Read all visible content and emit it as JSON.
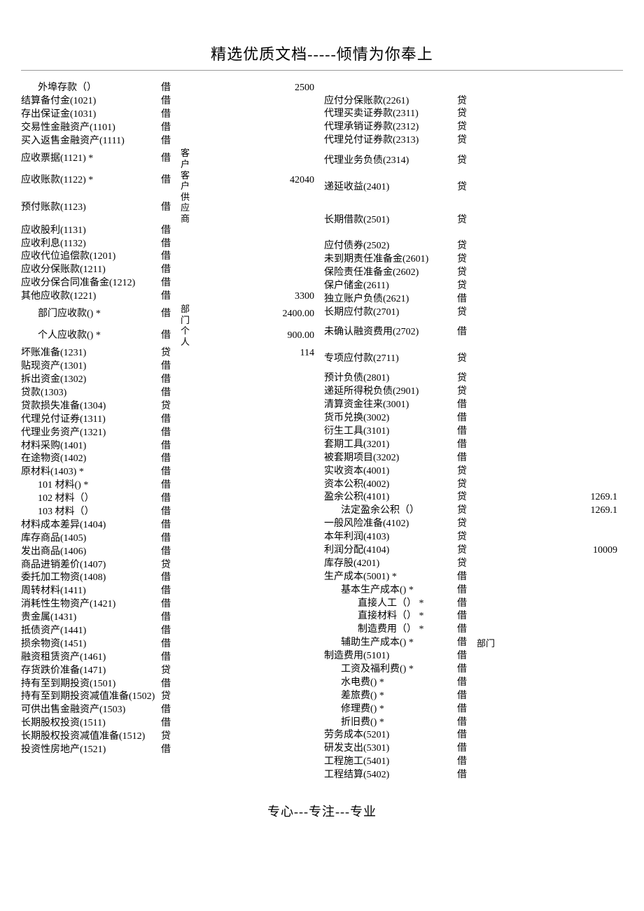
{
  "header_title": "精选优质文档-----倾情为你奉上",
  "footer_text": "专心---专注---专业",
  "left_rows": [
    {
      "label": "外埠存款（）",
      "dc": "借",
      "ex": "",
      "val": "2500",
      "indent": 1
    },
    {
      "label": "结算备付金(1021)",
      "dc": "借",
      "ex": "",
      "val": ""
    },
    {
      "label": "存出保证金(1031)",
      "dc": "借",
      "ex": "",
      "val": ""
    },
    {
      "label": "交易性金融资产(1101)",
      "dc": "借",
      "ex": "",
      "val": ""
    },
    {
      "label": "买入返售金融资产(1111)",
      "dc": "借",
      "ex": "",
      "val": ""
    },
    {
      "label": "应收票据(1121) *",
      "dc": "借",
      "ex": "客\n户",
      "val": "",
      "multiline": true
    },
    {
      "label": "应收账款(1122) *",
      "dc": "借",
      "ex": "客\n户",
      "val": "42040",
      "multiline": true
    },
    {
      "label": "预付账款(1123)",
      "dc": "借",
      "ex": "供\n应\n商",
      "val": "",
      "multiline": true
    },
    {
      "label": "应收股利(1131)",
      "dc": "借",
      "ex": "",
      "val": ""
    },
    {
      "label": "应收利息(1132)",
      "dc": "借",
      "ex": "",
      "val": ""
    },
    {
      "label": "应收代位追偿款(1201)",
      "dc": "借",
      "ex": "",
      "val": ""
    },
    {
      "label": "应收分保账款(1211)",
      "dc": "借",
      "ex": "",
      "val": ""
    },
    {
      "label": "应收分保合同准备金(1212)",
      "dc": "借",
      "ex": "",
      "val": ""
    },
    {
      "label": "其他应收款(1221)",
      "dc": "借",
      "ex": "",
      "val": "3300"
    },
    {
      "label": "部门应收款() *",
      "dc": "借",
      "ex": "部\n门",
      "val": "2400.00",
      "indent": 1,
      "multiline": true
    },
    {
      "label": "个人应收款() *",
      "dc": "借",
      "ex": "个\n人",
      "val": "900.00",
      "indent": 1,
      "multiline": true
    },
    {
      "label": "坏账准备(1231)",
      "dc": "贷",
      "ex": "",
      "val": "114"
    },
    {
      "label": "贴现资产(1301)",
      "dc": "借",
      "ex": "",
      "val": ""
    },
    {
      "label": "拆出资金(1302)",
      "dc": "借",
      "ex": "",
      "val": ""
    },
    {
      "label": "贷款(1303)",
      "dc": "借",
      "ex": "",
      "val": ""
    },
    {
      "label": "贷款损失准备(1304)",
      "dc": "贷",
      "ex": "",
      "val": ""
    },
    {
      "label": "代理兑付证券(1311)",
      "dc": "借",
      "ex": "",
      "val": ""
    },
    {
      "label": "代理业务资产(1321)",
      "dc": "借",
      "ex": "",
      "val": ""
    },
    {
      "label": "材料采购(1401)",
      "dc": "借",
      "ex": "",
      "val": ""
    },
    {
      "label": "在途物资(1402)",
      "dc": "借",
      "ex": "",
      "val": ""
    },
    {
      "label": "原材料(1403) *",
      "dc": "借",
      "ex": "",
      "val": ""
    },
    {
      "label": "101 材料() *",
      "dc": "借",
      "ex": "",
      "val": "",
      "indent": 1
    },
    {
      "label": "102 材料（）",
      "dc": "借",
      "ex": "",
      "val": "",
      "indent": 1
    },
    {
      "label": "103 材料（）",
      "dc": "借",
      "ex": "",
      "val": "",
      "indent": 1
    },
    {
      "label": "材料成本差异(1404)",
      "dc": "借",
      "ex": "",
      "val": ""
    },
    {
      "label": "库存商品(1405)",
      "dc": "借",
      "ex": "",
      "val": ""
    },
    {
      "label": "发出商品(1406)",
      "dc": "借",
      "ex": "",
      "val": ""
    },
    {
      "label": "商品进销差价(1407)",
      "dc": "贷",
      "ex": "",
      "val": ""
    },
    {
      "label": "委托加工物资(1408)",
      "dc": "借",
      "ex": "",
      "val": ""
    },
    {
      "label": "周转材料(1411)",
      "dc": "借",
      "ex": "",
      "val": ""
    },
    {
      "label": "消耗性生物资产(1421)",
      "dc": "借",
      "ex": "",
      "val": ""
    },
    {
      "label": "贵金属(1431)",
      "dc": "借",
      "ex": "",
      "val": ""
    },
    {
      "label": "抵债资产(1441)",
      "dc": "借",
      "ex": "",
      "val": ""
    },
    {
      "label": "损余物资(1451)",
      "dc": "借",
      "ex": "",
      "val": ""
    },
    {
      "label": "融资租赁资产(1461)",
      "dc": "借",
      "ex": "",
      "val": ""
    },
    {
      "label": "存货跌价准备(1471)",
      "dc": "贷",
      "ex": "",
      "val": ""
    },
    {
      "label": "持有至到期投资(1501)",
      "dc": "借",
      "ex": "",
      "val": ""
    },
    {
      "label": "持有至到期投资减值准备(1502)",
      "dc": "贷",
      "ex": "",
      "val": ""
    },
    {
      "label": "可供出售金融资产(1503)",
      "dc": "借",
      "ex": "",
      "val": ""
    },
    {
      "label": "长期股权投资(1511)",
      "dc": "借",
      "ex": "",
      "val": ""
    },
    {
      "label": "长期股权投资减值准备(1512)",
      "dc": "贷",
      "ex": "",
      "val": ""
    },
    {
      "label": "投资性房地产(1521)",
      "dc": "借",
      "ex": "",
      "val": ""
    }
  ],
  "right_rows": [
    {
      "label": "",
      "dc": "",
      "ex": "",
      "val": ""
    },
    {
      "label": "应付分保账款(2261)",
      "dc": "贷",
      "ex": "",
      "val": ""
    },
    {
      "label": "代理买卖证券款(2311)",
      "dc": "贷",
      "ex": "",
      "val": ""
    },
    {
      "label": "代理承销证券款(2312)",
      "dc": "贷",
      "ex": "",
      "val": ""
    },
    {
      "label": "代理兑付证券款(2313)",
      "dc": "贷",
      "ex": "",
      "val": ""
    },
    {
      "label": "代理业务负债(2314)",
      "dc": "贷",
      "ex": "",
      "val": "",
      "multiline_spacer": true
    },
    {
      "label": "递延收益(2401)",
      "dc": "贷",
      "ex": "",
      "val": "",
      "multiline_spacer": true
    },
    {
      "label": "长期借款(2501)",
      "dc": "贷",
      "ex": "",
      "val": "",
      "multiline_spacer3": true
    },
    {
      "label": "应付债券(2502)",
      "dc": "贷",
      "ex": "",
      "val": ""
    },
    {
      "label": "未到期责任准备金(2601)",
      "dc": "贷",
      "ex": "",
      "val": ""
    },
    {
      "label": "保险责任准备金(2602)",
      "dc": "贷",
      "ex": "",
      "val": ""
    },
    {
      "label": "保户储金(2611)",
      "dc": "贷",
      "ex": "",
      "val": ""
    },
    {
      "label": "独立账户负债(2621)",
      "dc": "借",
      "ex": "",
      "val": ""
    },
    {
      "label": "长期应付款(2701)",
      "dc": "贷",
      "ex": "",
      "val": ""
    },
    {
      "label": "未确认融资费用(2702)",
      "dc": "借",
      "ex": "",
      "val": "",
      "multiline_spacer": true
    },
    {
      "label": "专项应付款(2711)",
      "dc": "贷",
      "ex": "",
      "val": "",
      "multiline_spacer": true
    },
    {
      "label": "预计负债(2801)",
      "dc": "贷",
      "ex": "",
      "val": ""
    },
    {
      "label": "递延所得税负债(2901)",
      "dc": "贷",
      "ex": "",
      "val": ""
    },
    {
      "label": "清算资金往来(3001)",
      "dc": "借",
      "ex": "",
      "val": ""
    },
    {
      "label": "货币兑换(3002)",
      "dc": "借",
      "ex": "",
      "val": ""
    },
    {
      "label": "衍生工具(3101)",
      "dc": "借",
      "ex": "",
      "val": ""
    },
    {
      "label": "套期工具(3201)",
      "dc": "借",
      "ex": "",
      "val": ""
    },
    {
      "label": "被套期项目(3202)",
      "dc": "借",
      "ex": "",
      "val": ""
    },
    {
      "label": "实收资本(4001)",
      "dc": "贷",
      "ex": "",
      "val": ""
    },
    {
      "label": "资本公积(4002)",
      "dc": "贷",
      "ex": "",
      "val": ""
    },
    {
      "label": "盈余公积(4101)",
      "dc": "贷",
      "ex": "",
      "val": "1269.1"
    },
    {
      "label": "法定盈余公积（）",
      "dc": "贷",
      "ex": "",
      "val": "1269.1",
      "indent": 1
    },
    {
      "label": "一般风险准备(4102)",
      "dc": "贷",
      "ex": "",
      "val": ""
    },
    {
      "label": "本年利润(4103)",
      "dc": "贷",
      "ex": "",
      "val": ""
    },
    {
      "label": "利润分配(4104)",
      "dc": "贷",
      "ex": "",
      "val": "10009"
    },
    {
      "label": "库存股(4201)",
      "dc": "贷",
      "ex": "",
      "val": ""
    },
    {
      "label": "生产成本(5001) *",
      "dc": "借",
      "ex": "",
      "val": ""
    },
    {
      "label": "基本生产成本() *",
      "dc": "借",
      "ex": "",
      "val": "",
      "indent": 1
    },
    {
      "label": "直接人工（） *",
      "dc": "借",
      "ex": "",
      "val": "",
      "indent": 2
    },
    {
      "label": "直接材料（） *",
      "dc": "借",
      "ex": "",
      "val": "",
      "indent": 2
    },
    {
      "label": "制造费用（）  *",
      "dc": "借",
      "ex": "",
      "val": "",
      "indent": 2
    },
    {
      "label": "辅助生产成本() *",
      "dc": "借",
      "ex": "部门",
      "val": "",
      "indent": 1
    },
    {
      "label": "制造费用(5101)",
      "dc": "借",
      "ex": "",
      "val": ""
    },
    {
      "label": "工资及福利费() *",
      "dc": "借",
      "ex": "",
      "val": "",
      "indent": 1
    },
    {
      "label": "水电费() *",
      "dc": "借",
      "ex": "",
      "val": "",
      "indent": 1
    },
    {
      "label": "差旅费() *",
      "dc": "借",
      "ex": "",
      "val": "",
      "indent": 1
    },
    {
      "label": "修理费() *",
      "dc": "借",
      "ex": "",
      "val": "",
      "indent": 1
    },
    {
      "label": "折旧费() *",
      "dc": "借",
      "ex": "",
      "val": "",
      "indent": 1
    },
    {
      "label": "劳务成本(5201)",
      "dc": "借",
      "ex": "",
      "val": ""
    },
    {
      "label": "研发支出(5301)",
      "dc": "借",
      "ex": "",
      "val": ""
    },
    {
      "label": "工程施工(5401)",
      "dc": "借",
      "ex": "",
      "val": ""
    },
    {
      "label": "工程结算(5402)",
      "dc": "借",
      "ex": "",
      "val": ""
    }
  ]
}
